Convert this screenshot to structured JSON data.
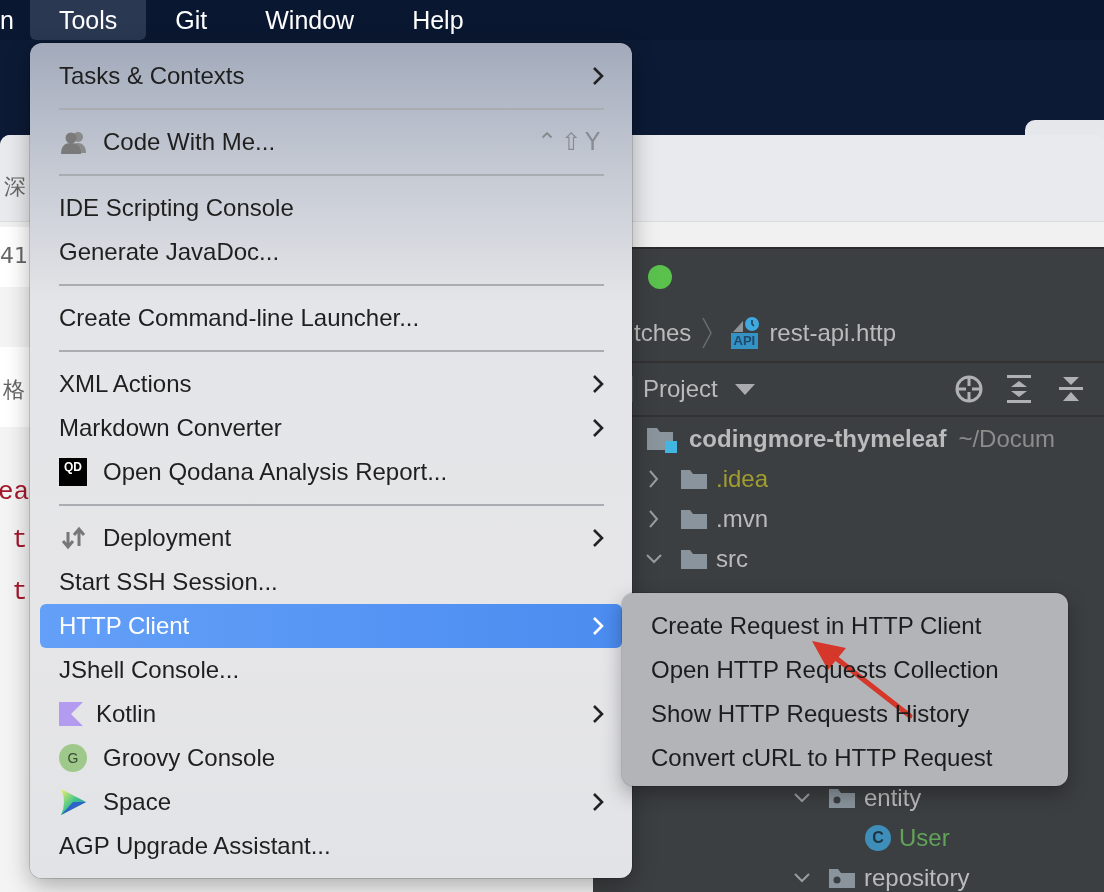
{
  "menu_bar": [
    {
      "label": "n",
      "selected": false
    },
    {
      "label": "Tools",
      "selected": true
    },
    {
      "label": "Git",
      "selected": false
    },
    {
      "label": "Window",
      "selected": false
    },
    {
      "label": "Help",
      "selected": false
    }
  ],
  "background_page": {
    "side_texts": [
      "深",
      "41",
      "格"
    ],
    "code_lines": [
      "ea",
      "t",
      "t"
    ]
  },
  "tools_menu": {
    "groups": [
      [
        {
          "label": "Tasks & Contexts",
          "submenu": true,
          "selected": false
        }
      ],
      [
        {
          "label": "Code With Me...",
          "shortcut": "⌃⇧Y",
          "submenu": false,
          "selected": false
        }
      ],
      [
        {
          "label": "IDE Scripting Console",
          "submenu": false,
          "selected": false
        },
        {
          "label": "Generate JavaDoc...",
          "submenu": false,
          "selected": false
        }
      ],
      [
        {
          "label": "Create Command-line Launcher...",
          "submenu": false,
          "selected": false
        }
      ],
      [
        {
          "label": "XML Actions",
          "submenu": true,
          "selected": false
        },
        {
          "label": "Markdown Converter",
          "submenu": true,
          "selected": false
        },
        {
          "label": "Open Qodana Analysis Report...",
          "badge": "QD",
          "submenu": false,
          "selected": false
        }
      ],
      [
        {
          "label": "Deployment",
          "submenu": true,
          "selected": false
        },
        {
          "label": "Start SSH Session...",
          "submenu": false,
          "selected": false
        },
        {
          "label": "HTTP Client",
          "submenu": true,
          "selected": true
        },
        {
          "label": "JShell Console...",
          "submenu": false,
          "selected": false
        },
        {
          "label": "Kotlin",
          "submenu": true,
          "selected": false
        },
        {
          "label": "Groovy Console",
          "badge": "G",
          "submenu": false,
          "selected": false
        },
        {
          "label": "Space",
          "submenu": true,
          "selected": false
        },
        {
          "label": "AGP Upgrade Assistant...",
          "submenu": false,
          "selected": false
        }
      ]
    ]
  },
  "http_client_submenu": [
    {
      "label": "Create Request in HTTP Client",
      "selected": false
    },
    {
      "label": "Open HTTP Requests Collection",
      "selected": false
    },
    {
      "label": "Show HTTP Requests History",
      "selected": false
    },
    {
      "label": "Convert cURL to HTTP Request",
      "selected": false
    }
  ],
  "ide": {
    "breadcrumb": [
      {
        "label": "tches"
      },
      {
        "label": "rest-api.http",
        "badge": "API"
      }
    ],
    "tool_window": {
      "title": "Project"
    },
    "tree": [
      {
        "label": "codingmore-thymeleaf",
        "path": "~/Docum",
        "kind": "module",
        "color": "#bbbbbb",
        "children": [
          {
            "label": ".idea",
            "kind": "folder",
            "color": "#a19d2f",
            "expanded": false
          },
          {
            "label": ".mvn",
            "kind": "folder",
            "color": "#bbbbbb",
            "expanded": false
          },
          {
            "label": "src",
            "kind": "folder",
            "color": "#bbbbbb",
            "expanded": true
          }
        ]
      }
    ],
    "tree_lower": [
      {
        "label": "entity",
        "kind": "package",
        "color": "#bbbbbb",
        "expanded": true,
        "children": [
          {
            "label": "User",
            "kind": "class",
            "badge": "C",
            "color": "#62a35a"
          }
        ]
      },
      {
        "label": "repository",
        "kind": "package",
        "color": "#bbbbbb",
        "expanded": true
      }
    ]
  }
}
